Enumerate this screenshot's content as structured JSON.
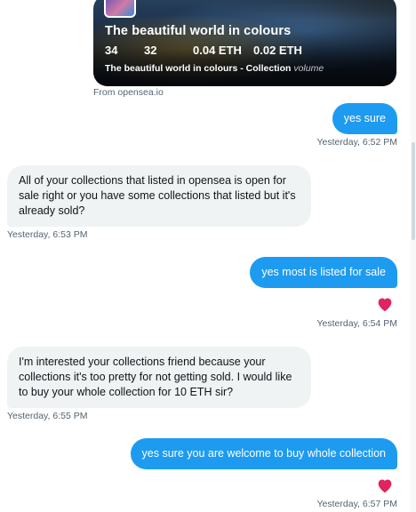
{
  "preview": {
    "title": "The beautiful world in colours",
    "stats": [
      "34",
      "32",
      "0.04 ETH",
      "0.02 ETH"
    ],
    "subtitle": "The beautiful world in colours - Collection",
    "subtitle_faded": "volume",
    "source": "From opensea.io"
  },
  "messages": [
    {
      "direction": "out",
      "text": "yes sure",
      "timestamp": "Yesterday, 6:52 PM",
      "liked": false
    },
    {
      "direction": "in",
      "text": "All of your collections that listed in opensea is open for sale right or you have some collections that listed but it's already sold?",
      "timestamp": "Yesterday, 6:53 PM"
    },
    {
      "direction": "out",
      "text": "yes most is listed for sale",
      "timestamp": "Yesterday, 6:54 PM",
      "liked": true
    },
    {
      "direction": "in",
      "text": "I'm interested your collections friend because your collections it's too pretty for not getting sold. I would like to buy your whole collection for 10 ETH sir?",
      "timestamp": "Yesterday, 6:55 PM"
    },
    {
      "direction": "out",
      "text": "yes sure you are welcome to buy whole collection",
      "timestamp": "Yesterday, 6:57 PM",
      "liked": true
    }
  ],
  "colors": {
    "outgoing": "#1d9bf0",
    "incoming": "#eff3f4",
    "heart": "#e0245e"
  },
  "icons": {
    "reaction": "heart-icon"
  }
}
